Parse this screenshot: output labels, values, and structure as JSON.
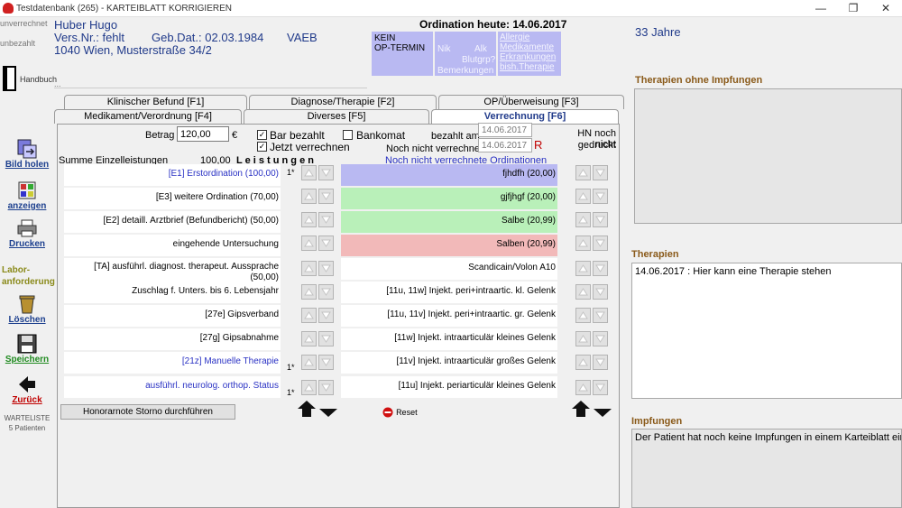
{
  "window": {
    "title": "Testdatenbank (265) - KARTEIBLATT KORRIGIEREN",
    "btn_min": "—",
    "btn_restore": "❐",
    "btn_close": "✕"
  },
  "sidebar": {
    "unverrechnet": "unverrechnet",
    "unbezahlt": "unbezahlt",
    "handbuch": "Handbuch",
    "bild_holen": "Bild holen",
    "anzeigen": "anzeigen",
    "drucken": "Drucken",
    "labor": "Labor-",
    "anforderung": "anforderung",
    "loeschen": "Löschen",
    "speichern": "Speichern",
    "zurueck": "Zurück",
    "warteliste": "WARTELISTE",
    "patienten": "5 Patienten"
  },
  "patient": {
    "name": "Huber Hugo",
    "versnr": "Vers.Nr.:  fehlt",
    "gebdat": "Geb.Dat.: 02.03.1984",
    "kasse": "VAEB",
    "address": "1040 Wien, Musterstraße 34/2",
    "age": "33 Jahre",
    "note_placeholder": "..."
  },
  "header": {
    "ordination": "Ordination heute: 14.06.2017",
    "kein_op": "KEIN",
    "op_termin": "OP-TERMIN",
    "nik": "Nik",
    "alk": "Alk",
    "blutgrp": "Blutgrp?",
    "bemerkungen": "Bemerkungen",
    "allergie": "Allergie",
    "medikamente": "Medikamente",
    "erkrankungen": "Erkrankungen",
    "bish_therapie": "bish.Therapie"
  },
  "tabs": {
    "row1": [
      "Klinischer Befund  [F1]",
      "Diagnose/Therapie  [F2]",
      "OP/Überweisung  [F3]"
    ],
    "row2": [
      "Medikament/Verordnung  [F4]",
      "Diverses  [F5]",
      "Verrechnung  [F6]"
    ]
  },
  "billing": {
    "betrag_label": "Betrag",
    "betrag_value": "120,00",
    "currency": "€",
    "bar_bezahlt": "Bar bezahlt",
    "bankomat": "Bankomat",
    "jetzt_verrechnen": "Jetzt verrechnen",
    "bezahlt_am": "bezahlt am",
    "date1": "14.06.2017",
    "noch_nicht": "Noch nicht verrechnet",
    "date2": "14.06.2017",
    "r_marker": "R",
    "hn_noch_nicht": "HN noch nicht",
    "gedruckt": "gedruckt",
    "summe_label": "Summe Einzelleistungen",
    "summe_value": "100,00",
    "leistungen": "L e i s t u n g e n",
    "nicht_verrechnete": "Noch nicht verrechnete Ordinationen"
  },
  "left_items": [
    {
      "text": "[E1]  Erstordination (100,00)",
      "count": "1*"
    },
    {
      "text": "[E3]  weitere Ordination (70,00)",
      "count": ""
    },
    {
      "text": "[E2]  detaill. Arztbrief (Befundbericht) (50,00)",
      "count": ""
    },
    {
      "text": "eingehende Untersuchung",
      "count": ""
    },
    {
      "text": "[TA]  ausführl. diagnost. therapeut. Aussprache",
      "text2": "(50,00)",
      "count": ""
    },
    {
      "text": "Zuschlag f. Unters. bis 6. Lebensjahr",
      "count": ""
    },
    {
      "text": "[27e]  Gipsverband",
      "count": ""
    },
    {
      "text": "[27g]  Gipsabnahme",
      "count": ""
    },
    {
      "text": "[21z]  Manuelle Therapie",
      "count": "1*"
    },
    {
      "text": "ausführl. neurolog. orthop. Status",
      "count": "1*"
    }
  ],
  "right_items": [
    {
      "text": "fjhdfh (20,00)"
    },
    {
      "text": "gjfjhgf (20,00)"
    },
    {
      "text": "Salbe (20,99)"
    },
    {
      "text": "Salben (20,99)"
    },
    {
      "text": "Scandicain/Volon A10"
    },
    {
      "text": "[11u, 11w]  Injekt. peri+intraartic. kl. Gelenk"
    },
    {
      "text": "[11u, 11v]  Injekt. peri+intraartic. gr. Gelenk"
    },
    {
      "text": "[11w]  Injekt. intraarticulär kleines Gelenk"
    },
    {
      "text": "[11v]  Injekt. intraarticulär großes Gelenk"
    },
    {
      "text": "[11u]  Injekt. periarticulär kleines Gelenk"
    }
  ],
  "actions": {
    "storno": "Honorarnote Storno durchführen",
    "reset": "Reset"
  },
  "right_panel": {
    "therapien_ohne": "Therapien ohne Impfungen",
    "therapien": "Therapien",
    "therapie_entry": "14.06.2017  : Hier kann eine Therapie stehen",
    "impfungen": "Impfungen",
    "impfungen_text": "Der Patient hat noch keine Impfungen in einem Karteiblatt eingetragen"
  },
  "colors": {
    "accent_blue": "#203a8a",
    "badge": "#b9b9f2",
    "row_blue": "#b9b9f2",
    "row_green": "#b9f0b9",
    "row_red": "#f2b9b9",
    "heading_brown": "#8a5a1a"
  }
}
